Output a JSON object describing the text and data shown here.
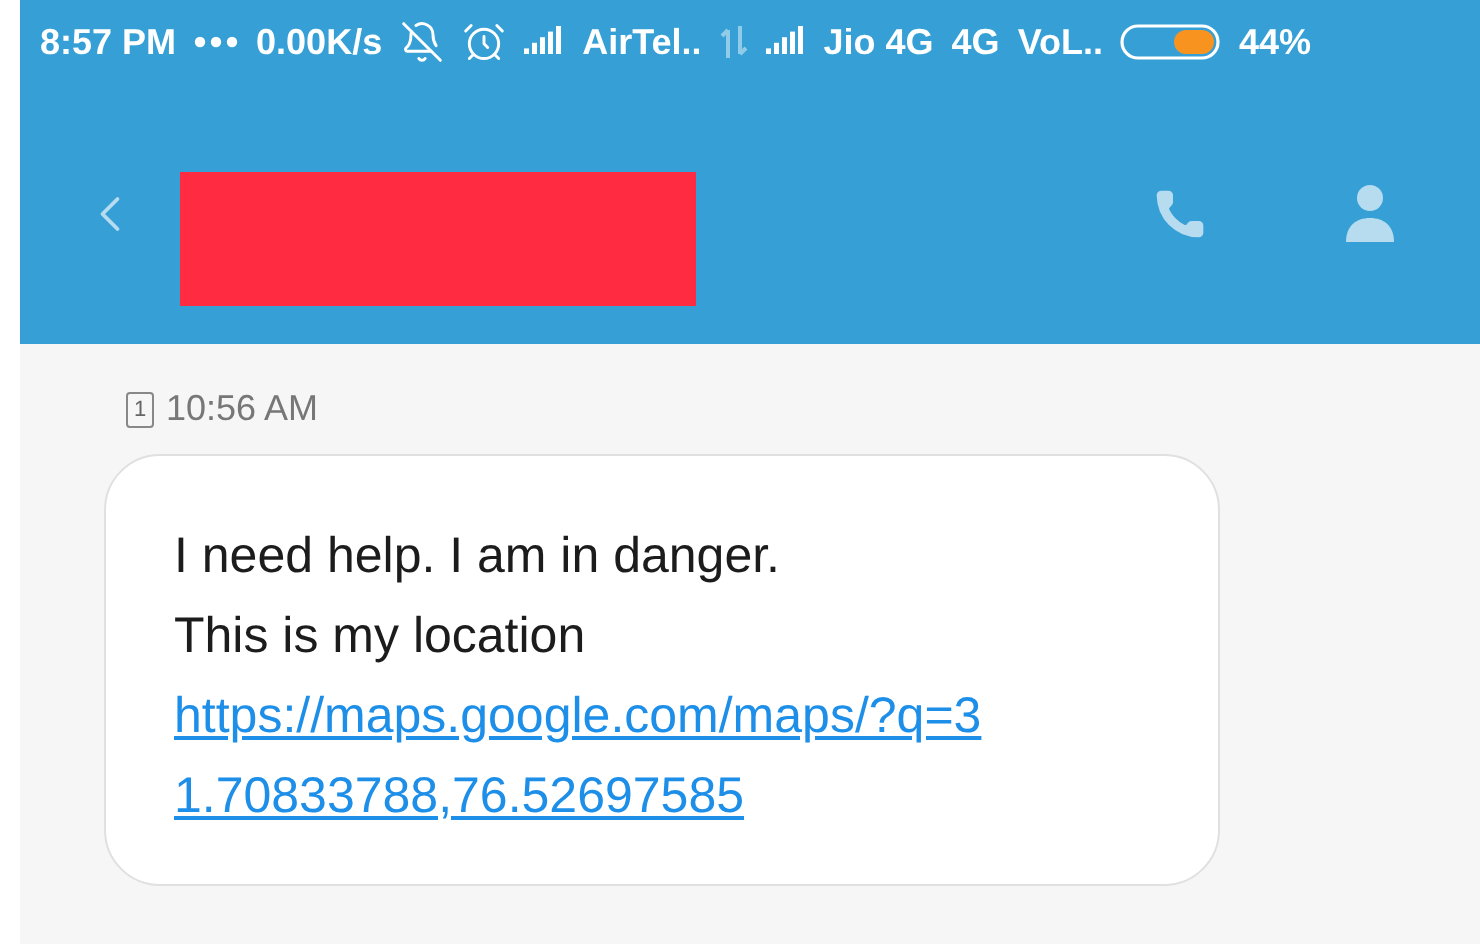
{
  "status_bar": {
    "time": "8:57 PM",
    "speed": "0.00K/s",
    "carrier_1": "AirTel..",
    "carrier_2": "Jio 4G",
    "network": "4G",
    "volte": "VoL..",
    "battery": "44%"
  },
  "header": {
    "contact_redacted": true
  },
  "messages": [
    {
      "sim": "1",
      "time": "10:56 AM",
      "text": "I need help. I am in danger. This is my location ",
      "link": "https://maps.google.com/maps/?q=31.70833788,76.52697585"
    }
  ]
}
